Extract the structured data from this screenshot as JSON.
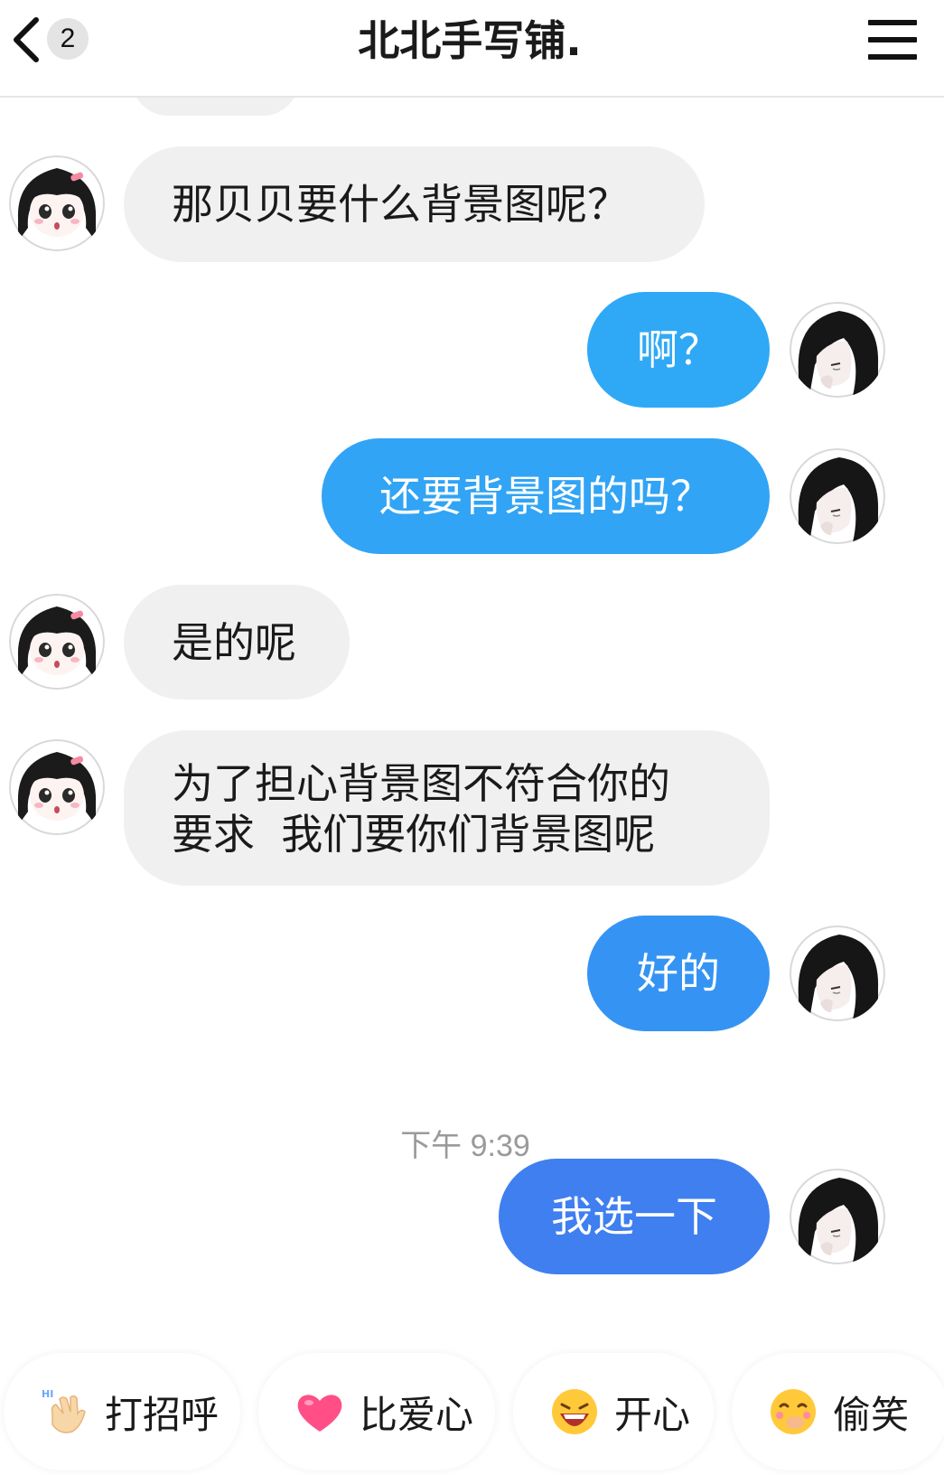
{
  "header": {
    "unread_count": "2",
    "title": "北北手写铺."
  },
  "messages": [
    {
      "side": "in",
      "text": "那贝贝要什么背景图呢？"
    },
    {
      "side": "out",
      "text": "啊？"
    },
    {
      "side": "out",
      "text": "还要背景图的吗？"
    },
    {
      "side": "in",
      "text": "是的呢"
    },
    {
      "side": "in",
      "line1": "为了担心背景图不符合你的",
      "line2": "要求  我们要你们背景图呢"
    },
    {
      "side": "out",
      "text": "好的"
    },
    {
      "side": "out",
      "text": "我选一下"
    }
  ],
  "timestamp": "下午 9:39",
  "quick_replies": [
    {
      "label": "打招呼",
      "icon": "waving-hand-icon"
    },
    {
      "label": "比爱心",
      "icon": "heart-icon"
    },
    {
      "label": "开心",
      "icon": "laughing-face-icon"
    },
    {
      "label": "偷笑",
      "icon": "giggle-face-icon"
    }
  ],
  "colors": {
    "incoming_bubble": "#f0f0f0",
    "outgoing_bubble_light": "#2fa9f5",
    "outgoing_bubble_mid": "#3594f3",
    "outgoing_bubble_dark": "#3f7ff0"
  }
}
